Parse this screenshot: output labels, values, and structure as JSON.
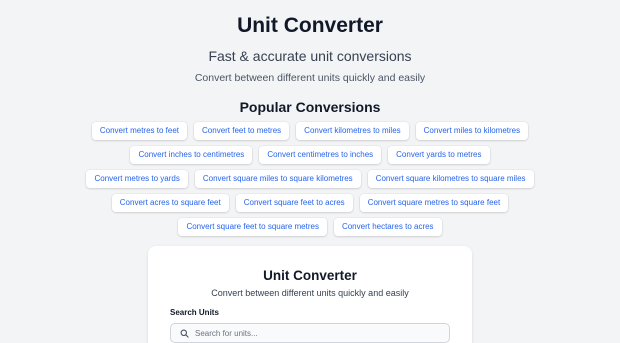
{
  "hero": {
    "title": "Unit Converter",
    "tagline": "Fast & accurate unit conversions",
    "subtitle": "Convert between different units quickly and easily"
  },
  "popular": {
    "title": "Popular Conversions",
    "links": [
      "Convert metres to feet",
      "Convert feet to metres",
      "Convert kilometres to miles",
      "Convert miles to kilometres",
      "Convert inches to centimetres",
      "Convert centimetres to inches",
      "Convert yards to metres",
      "Convert metres to yards",
      "Convert square miles to square kilometres",
      "Convert square kilometres to square miles",
      "Convert acres to square feet",
      "Convert square feet to acres",
      "Convert square metres to square feet",
      "Convert square feet to square metres",
      "Convert hectares to acres"
    ]
  },
  "card": {
    "title": "Unit Converter",
    "subtitle": "Convert between different units quickly and easily",
    "search_label": "Search Units",
    "search_placeholder": "Search for units...",
    "search_value": "",
    "search_icon": "search-icon"
  },
  "colors": {
    "background": "#f3f4f6",
    "link": "#2563eb",
    "card": "#ffffff"
  }
}
